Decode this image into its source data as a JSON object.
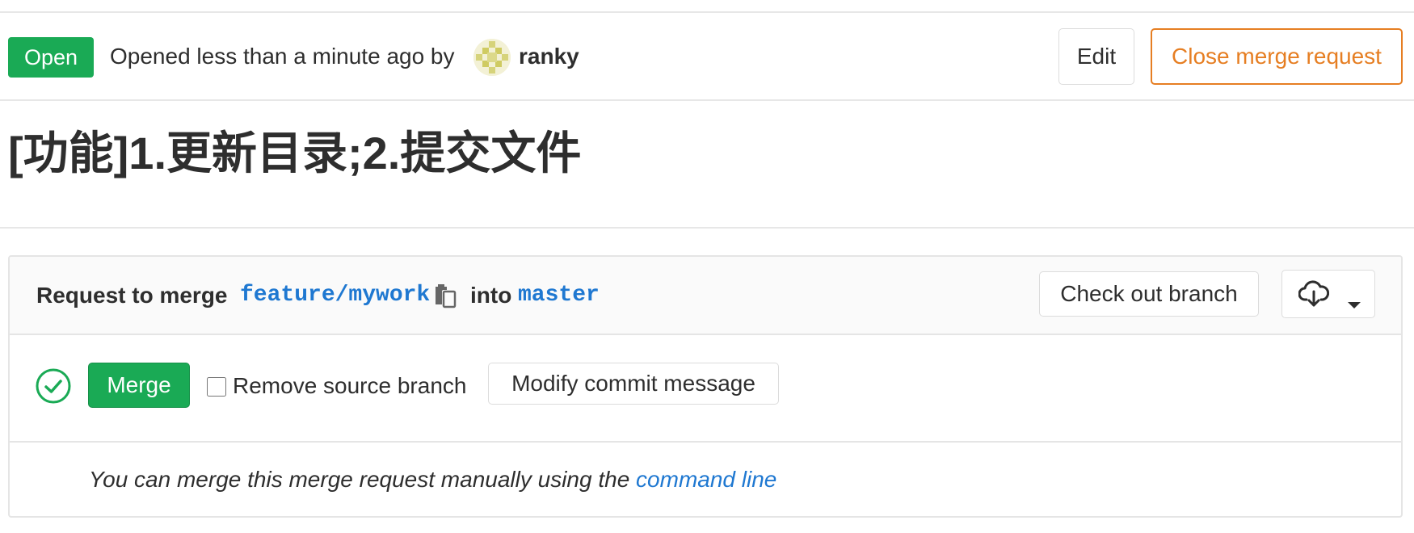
{
  "header": {
    "status": "Open",
    "opened_text": "Opened less than a minute ago by",
    "author": "ranky",
    "edit_label": "Edit",
    "close_label": "Close merge request"
  },
  "title": "[功能]1.更新目录;2.提交文件",
  "widget": {
    "request_text": "Request to merge",
    "source_branch": "feature/mywork",
    "into_text": "into",
    "target_branch": "master",
    "checkout_label": "Check out branch",
    "download_icon": "cloud-download-icon",
    "merge_label": "Merge",
    "remove_source_label": "Remove source branch",
    "remove_source_checked": false,
    "modify_commit_label": "Modify commit message",
    "manual_text": "You can merge this merge request manually using the",
    "command_line_link": "command line"
  },
  "colors": {
    "success": "#1aaa55",
    "warning": "#e67e22",
    "link": "#1f78d1"
  }
}
